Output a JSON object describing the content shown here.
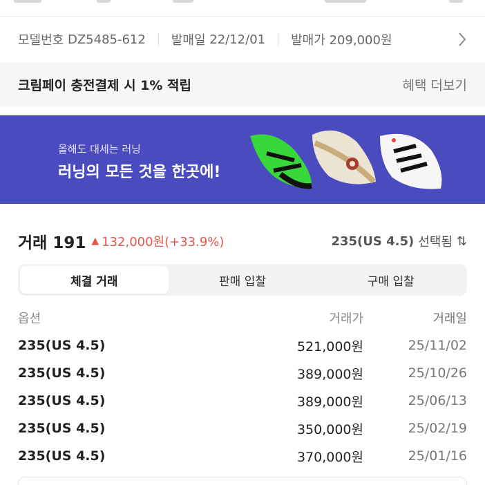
{
  "info": {
    "model_label": "모델번호",
    "model_value": "DZ5485-612",
    "release_label": "발매일",
    "release_value": "22/12/01",
    "price_label": "발매가",
    "price_value": "209,000원"
  },
  "pay": {
    "text": "크림페이 충전결제 시 1% 적립",
    "more": "혜택 더보기"
  },
  "banner": {
    "subtitle": "올해도 대세는 러닝",
    "title": "러닝의 모든 것을 한곳에!",
    "background": "#4a4bbf",
    "shoes": [
      "green-asics-shoe",
      "beige-on-shoe",
      "white-adidas-shoe"
    ]
  },
  "trade": {
    "label": "거래 191",
    "change_arrow": "▲",
    "change": "132,000원(+33.9%)",
    "change_color": "#e2574c",
    "selected_size": "235(US 4.5)",
    "selected_suffix": "선택됨",
    "swap_glyph": "⇅"
  },
  "tabs": [
    {
      "label": "체결 거래",
      "active": true
    },
    {
      "label": "판매 입찰",
      "active": false
    },
    {
      "label": "구매 입찰",
      "active": false
    }
  ],
  "table": {
    "headers": [
      "옵션",
      "거래가",
      "거래일"
    ],
    "rows": [
      [
        "235(US 4.5)",
        "521,000원",
        "25/11/02"
      ],
      [
        "235(US 4.5)",
        "389,000원",
        "25/10/26"
      ],
      [
        "235(US 4.5)",
        "389,000원",
        "25/06/13"
      ],
      [
        "235(US 4.5)",
        "350,000원",
        "25/02/19"
      ],
      [
        "235(US 4.5)",
        "370,000원",
        "25/01/16"
      ]
    ]
  }
}
